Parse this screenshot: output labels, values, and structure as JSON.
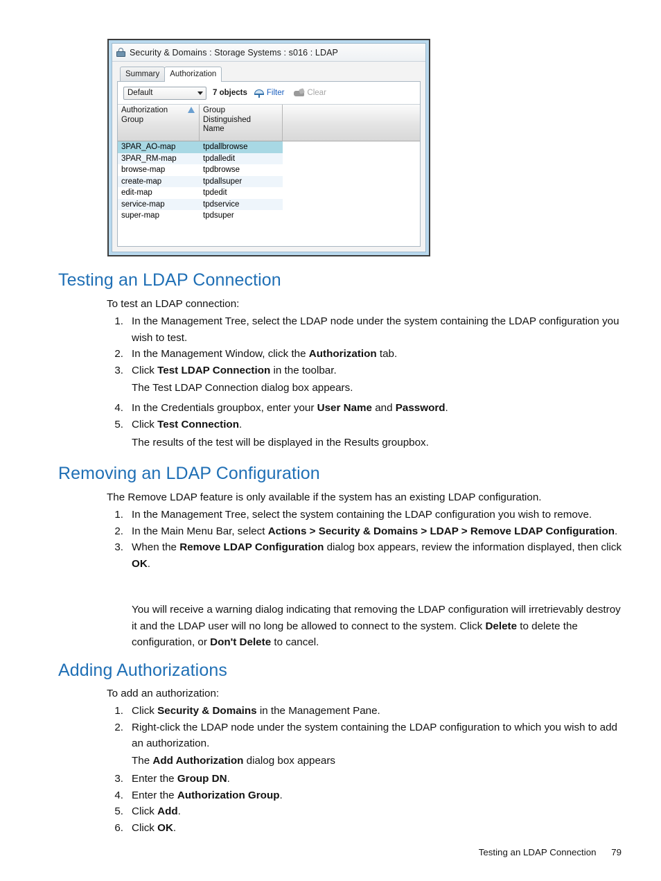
{
  "figure": {
    "window": {
      "icon": "lock-icon",
      "title": "Security & Domains : Storage Systems : s016 : LDAP",
      "tabs": [
        {
          "label": "Summary",
          "active": false
        },
        {
          "label": "Authorization",
          "active": true
        }
      ],
      "toolbar": {
        "filter_select_value": "Default",
        "object_count": "7 objects",
        "filter_label": "Filter",
        "filter_icon": "filter-funnel-icon",
        "clear_label": "Clear",
        "clear_icon": "clear-filter-icon"
      },
      "table": {
        "columns": [
          "Authorization Group",
          "Group Distinguished Name",
          ""
        ],
        "column_lines": [
          [
            "Authorization",
            "Group"
          ],
          [
            "Group",
            "Distinguished",
            "Name"
          ],
          [
            ""
          ]
        ],
        "sort_column": 0,
        "sort_direction": "ascending",
        "rows": [
          {
            "group": "3PAR_AO-map",
            "dn": "tpdallbrowse",
            "selected": true
          },
          {
            "group": "3PAR_RM-map",
            "dn": "tpdalledit",
            "selected": false
          },
          {
            "group": "browse-map",
            "dn": "tpdbrowse",
            "selected": false
          },
          {
            "group": "create-map",
            "dn": "tpdallsuper",
            "selected": false
          },
          {
            "group": "edit-map",
            "dn": "tpdedit",
            "selected": false
          },
          {
            "group": "service-map",
            "dn": "tpdservice",
            "selected": false
          },
          {
            "group": "super-map",
            "dn": "tpdsuper",
            "selected": false
          }
        ]
      }
    }
  },
  "sections": {
    "testing": {
      "heading": "Testing an LDAP Connection",
      "intro": "To test an LDAP connection:",
      "steps": [
        {
          "num": "1.",
          "html": "In the Management Tree, select the LDAP node under the system containing the LDAP configuration you wish to test."
        },
        {
          "num": "2.",
          "html": "In the Management Window, click the <b>Authorization</b> tab."
        },
        {
          "num": "3.",
          "html": "Click <b>Test LDAP Connection</b> in the toolbar."
        }
      ],
      "note_after_3": "The Test LDAP Connection dialog box appears.",
      "steps_b": [
        {
          "num": "4.",
          "html": "In the Credentials groupbox, enter your <b>User Name</b> and <b>Password</b>."
        },
        {
          "num": "5.",
          "html": "Click <b>Test Connection</b>."
        }
      ],
      "note_after_5": "The results of the test will be displayed in the Results groupbox."
    },
    "removing": {
      "heading": "Removing an LDAP Configuration",
      "intro": "The Remove LDAP feature is only available if the system has an existing LDAP configuration.",
      "steps": [
        {
          "num": "1.",
          "html": "In the Management Tree, select the system containing the LDAP configuration you wish to remove."
        },
        {
          "num": "2.",
          "html": "In the Main Menu Bar, select <b>Actions &gt; Security &amp; Domains &gt; LDAP &gt; Remove LDAP Configuration</b>."
        },
        {
          "num": "3.",
          "html": "When the <b>Remove LDAP Configuration</b> dialog box appears, review the information displayed, then click <b>OK</b>."
        }
      ],
      "warning": "You will receive a warning dialog indicating that removing the LDAP configuration will irretrievably destroy it and the LDAP user will no long be allowed to connect to the system. Click <b>Delete</b> to delete the configuration, or <b>Don't Delete</b> to cancel."
    },
    "adding": {
      "heading": "Adding Authorizations",
      "intro": "To add an authorization:",
      "steps": [
        {
          "num": "1.",
          "html": "Click <b>Security &amp; Domains</b> in the Management Pane."
        },
        {
          "num": "2.",
          "html": "Right-click the LDAP node under the system containing the LDAP configuration to which you wish to add an authorization."
        }
      ],
      "note_after_2": "The <b>Add Authorization</b> dialog box appears",
      "steps_b": [
        {
          "num": "3.",
          "html": "Enter the <b>Group DN</b>."
        },
        {
          "num": "4.",
          "html": "Enter the <b>Authorization Group</b>."
        },
        {
          "num": "5.",
          "html": "Click <b>Add</b>."
        },
        {
          "num": "6.",
          "html": "Click <b>OK</b>."
        }
      ]
    }
  },
  "footer": {
    "chapter": "Testing an LDAP Connection",
    "page": "79"
  },
  "colors": {
    "heading_blue": "#1f6fb5",
    "link_blue": "#1a5fbf",
    "row_selected": "#a8d8e4",
    "row_alt": "#eef5fb",
    "window_frame": "#b9d9ee"
  }
}
